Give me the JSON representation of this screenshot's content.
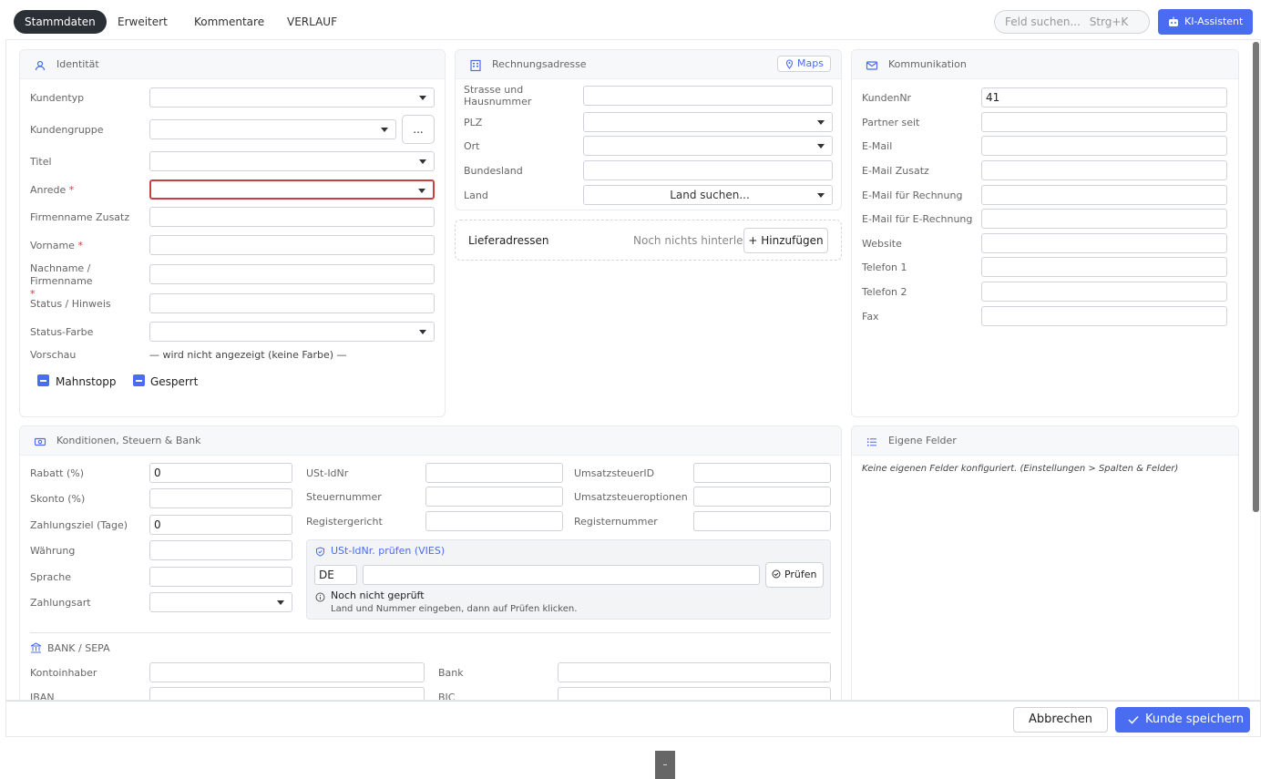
{
  "tabs": [
    "Stammdaten",
    "Erweitert",
    "Kommentare",
    "VERLAUF"
  ],
  "search": {
    "placeholder": "Feld suchen...",
    "shortcut": "Strg+K"
  },
  "ki_button": "KI-Assistent",
  "identity": {
    "title": "Identität",
    "fields": {
      "kundentyp": "Kundentyp",
      "kundengruppe": "Kundengruppe",
      "titel": "Titel",
      "anrede": "Anrede",
      "firmenname_zusatz": "Firmenname Zusatz",
      "vorname": "Vorname",
      "nachname": "Nachname / Firmenname",
      "status_hinweis": "Status / Hinweis",
      "status_farbe": "Status-Farbe",
      "vorschau": "Vorschau"
    },
    "required_mark": "*",
    "dots_label": "...",
    "vorschau_text": "— wird nicht angezeigt (keine Farbe) —",
    "mahnstopp": "Mahnstopp",
    "gesperrt": "Gesperrt"
  },
  "billing": {
    "title": "Rechnungsadresse",
    "maps": "Maps",
    "fields": {
      "strasse": "Strasse und Hausnummer",
      "plz": "PLZ",
      "ort": "Ort",
      "bundesland": "Bundesland",
      "land": "Land"
    },
    "land_placeholder": "Land suchen..."
  },
  "delivery": {
    "title": "Lieferadressen",
    "empty": "Noch nichts hinterlegt",
    "add": "+ Hinzufügen"
  },
  "comm": {
    "title": "Kommunikation",
    "fields": {
      "kundennr": "KundenNr",
      "partner_seit": "Partner seit",
      "email": "E-Mail",
      "email_zusatz": "E-Mail Zusatz",
      "email_rechnung": "E-Mail für Rechnung",
      "email_erechnung": "E-Mail für E-Rechnung",
      "website": "Website",
      "telefon1": "Telefon 1",
      "telefon2": "Telefon 2",
      "fax": "Fax"
    },
    "kundennr_value": "41"
  },
  "conditions": {
    "title": "Konditionen, Steuern & Bank",
    "fields": {
      "rabatt": "Rabatt (%)",
      "skonto": "Skonto (%)",
      "zahlungsziel": "Zahlungsziel (Tage)",
      "waehrung": "Währung",
      "sprache": "Sprache",
      "zahlungsart": "Zahlungsart",
      "ustidnr": "USt-IdNr",
      "steuernummer": "Steuernummer",
      "registergericht": "Registergericht",
      "umsatzsteuerid": "UmsatzsteuerID",
      "umsatzsteueroptionen": "Umsatzsteueroptionen",
      "registernummer": "Registernummer"
    },
    "rabatt_value": "0",
    "zahlungsziel_value": "0",
    "vies_title": "USt-IdNr. prüfen (VIES)",
    "vies_country": "DE",
    "vies_button": "Prüfen",
    "vies_status": "Noch nicht geprüft",
    "vies_hint": "Land und Nummer eingeben, dann auf Prüfen klicken.",
    "bank_title": "BANK / SEPA",
    "bank_fields": {
      "kontoinhaber": "Kontoinhaber",
      "bank": "Bank",
      "iban": "IBAN",
      "bic": "BIC"
    }
  },
  "custom": {
    "title": "Eigene Felder",
    "empty": "Keine eigenen Felder konfiguriert. (Einstellungen > Spalten & Felder)"
  },
  "footer": {
    "cancel": "Abbrechen",
    "save": "Kunde speichern"
  },
  "bottom_tab": "–",
  "colors": {
    "accent": "#4a6cf0",
    "error": "#c84040",
    "dark_tab": "#2b2f36"
  }
}
